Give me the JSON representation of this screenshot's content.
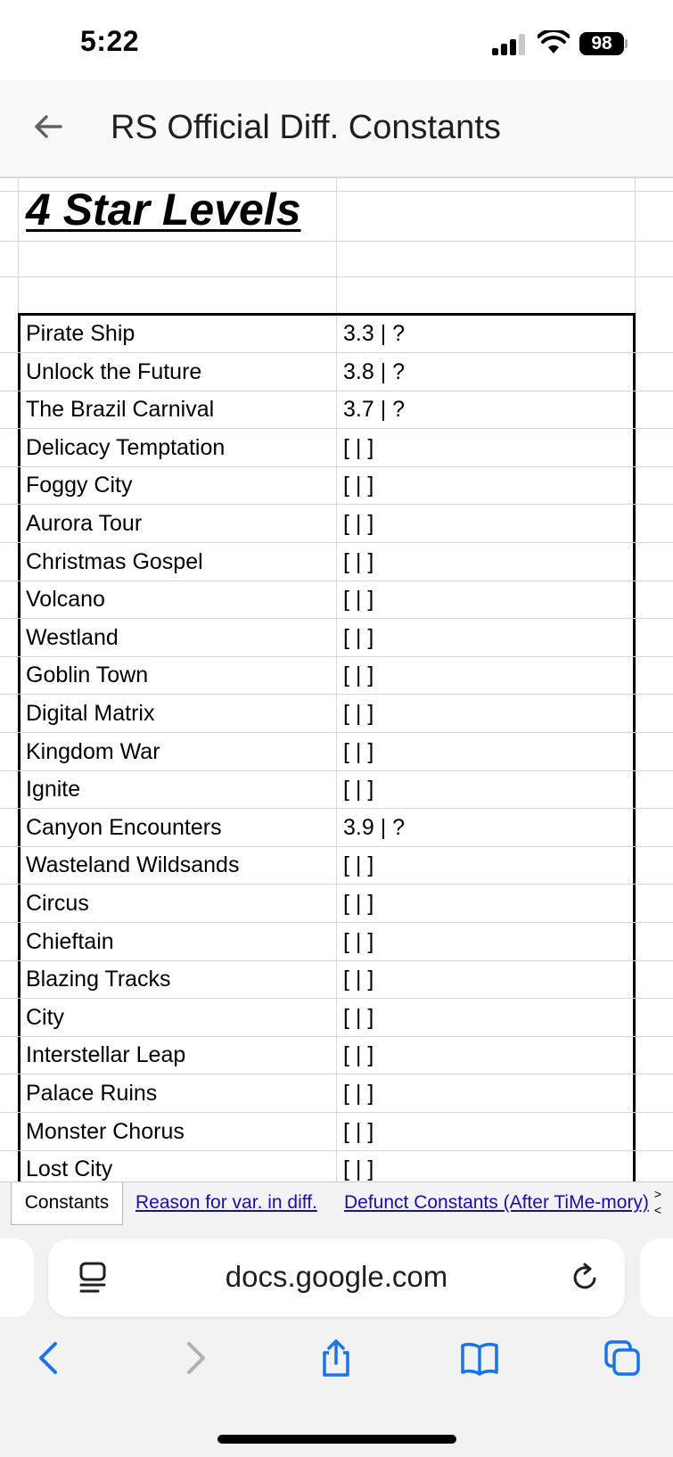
{
  "status_bar": {
    "time": "5:22",
    "battery": "98"
  },
  "header": {
    "title": "RS Official Diff. Constants"
  },
  "sheet": {
    "heading": "4 Star Levels",
    "rows": [
      {
        "name": "Pirate Ship",
        "value": "3.3 | ?"
      },
      {
        "name": "Unlock the Future",
        "value": "3.8 | ?"
      },
      {
        "name": "The Brazil Carnival",
        "value": "3.7 | ?"
      },
      {
        "name": "Delicacy Temptation",
        "value": "[ | ]"
      },
      {
        "name": "Foggy City",
        "value": "[ | ]"
      },
      {
        "name": "Aurora Tour",
        "value": "[ | ]"
      },
      {
        "name": "Christmas Gospel",
        "value": "[ | ]"
      },
      {
        "name": "Volcano",
        "value": "[ | ]"
      },
      {
        "name": "Westland",
        "value": "[ | ]"
      },
      {
        "name": "Goblin Town",
        "value": "[ | ]"
      },
      {
        "name": "Digital Matrix",
        "value": "[ | ]"
      },
      {
        "name": "Kingdom War",
        "value": "[ | ]"
      },
      {
        "name": "Ignite",
        "value": "[ | ]"
      },
      {
        "name": "Canyon Encounters",
        "value": "3.9 | ?"
      },
      {
        "name": "Wasteland Wildsands",
        "value": "[ | ]"
      },
      {
        "name": "Circus",
        "value": "[ | ]"
      },
      {
        "name": "Chieftain",
        "value": "[ | ]"
      },
      {
        "name": "Blazing Tracks",
        "value": "[ | ]"
      },
      {
        "name": "City",
        "value": "[ | ]"
      },
      {
        "name": "Interstellar Leap",
        "value": "[ | ]"
      },
      {
        "name": "Palace Ruins",
        "value": "[ | ]"
      },
      {
        "name": "Monster Chorus",
        "value": "[ | ]"
      },
      {
        "name": "Lost City",
        "value": "[ | ]"
      }
    ]
  },
  "tabs": {
    "active": "Constants",
    "links": [
      "Reason for var. in diff.",
      "Defunct Constants (After TiMe-mory)"
    ],
    "scroll_right": ">",
    "scroll_left": "<"
  },
  "browser": {
    "url": "docs.google.com",
    "icons": [
      "reader-icon",
      "reload-icon",
      "back-icon",
      "forward-icon",
      "share-icon",
      "bookmarks-icon",
      "tabs-icon"
    ]
  },
  "colors": {
    "link": "#1a0dab",
    "ios_blue": "#1a73e8",
    "disabled_grey": "#b0b0b0"
  }
}
